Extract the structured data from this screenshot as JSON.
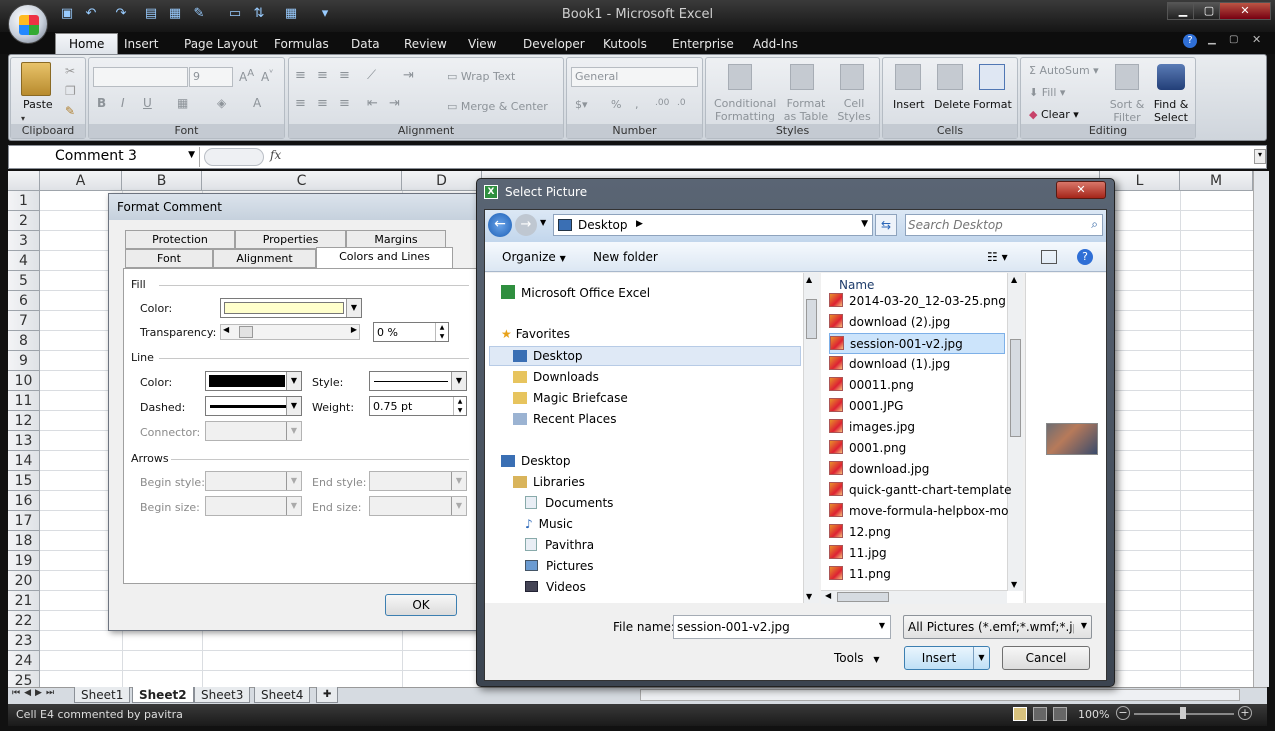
{
  "window": {
    "title": "Book1 - Microsoft Excel"
  },
  "ribbon_tabs": [
    "Home",
    "Insert",
    "Page Layout",
    "Formulas",
    "Data",
    "Review",
    "View",
    "Developer",
    "Kutools",
    "Enterprise",
    "Add-Ins"
  ],
  "ribbon": {
    "clipboard": {
      "label": "Clipboard",
      "paste": "Paste"
    },
    "font": {
      "label": "Font",
      "size": "9"
    },
    "alignment": {
      "label": "Alignment",
      "wrap_text": "Wrap Text",
      "merge_center": "Merge & Center"
    },
    "number": {
      "label": "Number",
      "format": "General"
    },
    "styles": {
      "label": "Styles",
      "conditional_1": "Conditional",
      "conditional_2": "Formatting",
      "format_table_1": "Format",
      "format_table_2": "as Table",
      "cell_styles_1": "Cell",
      "cell_styles_2": "Styles"
    },
    "cells": {
      "label": "Cells",
      "insert": "Insert",
      "delete": "Delete",
      "format": "Format"
    },
    "editing": {
      "label": "Editing",
      "autosum": "AutoSum",
      "fill": "Fill",
      "clear": "Clear",
      "sort_1": "Sort &",
      "sort_2": "Filter",
      "find_1": "Find &",
      "find_2": "Select"
    }
  },
  "formula_bar": {
    "name_box": "Comment 3",
    "fx": "fx",
    "formula": ""
  },
  "columns": [
    "A",
    "B",
    "C",
    "D",
    "L",
    "M"
  ],
  "rows": [
    "1",
    "2",
    "3",
    "4",
    "5",
    "6",
    "7",
    "8",
    "9",
    "10",
    "11",
    "12",
    "13",
    "14",
    "15",
    "16",
    "17",
    "18",
    "19",
    "20",
    "21",
    "22",
    "23",
    "24",
    "25"
  ],
  "sheets": [
    "Sheet1",
    "Sheet2",
    "Sheet3",
    "Sheet4"
  ],
  "active_sheet": "Sheet2",
  "status": {
    "text": "Cell E4 commented by pavitra",
    "zoom": "100%"
  },
  "format_comment": {
    "title": "Format Comment",
    "tabs_row1": [
      "Protection",
      "Properties",
      "Margins"
    ],
    "tabs_row2": [
      "Font",
      "Alignment",
      "Colors and Lines"
    ],
    "active_tab": "Colors and Lines",
    "fill_label": "Fill",
    "color_label": "Color:",
    "transparency_label": "Transparency:",
    "transparency_value": "0 %",
    "line_label": "Line",
    "line_color_label": "Color:",
    "style_label": "Style:",
    "dashed_label": "Dashed:",
    "weight_label": "Weight:",
    "weight_value": "0.75 pt",
    "connector_label": "Connector:",
    "arrows_label": "Arrows",
    "begin_style_label": "Begin style:",
    "end_style_label": "End style:",
    "begin_size_label": "Begin size:",
    "end_size_label": "End size:",
    "ok": "OK",
    "fill_color": "#ffffcc",
    "line_color": "#000000"
  },
  "select_picture": {
    "title": "Select Picture",
    "location": "Desktop",
    "search_placeholder": "Search Desktop",
    "organize": "Organize",
    "new_folder": "New folder",
    "name_header": "Name",
    "nav": {
      "top": "Microsoft Office Excel",
      "favorites": "Favorites",
      "fav_items": [
        "Desktop",
        "Downloads",
        "Magic Briefcase",
        "Recent Places"
      ],
      "desktop": "Desktop",
      "libraries": "Libraries",
      "lib_items": [
        "Documents",
        "Music",
        "Pavithra",
        "Pictures",
        "Videos"
      ]
    },
    "files": [
      "2014-03-20_12-03-25.png",
      "download (2).jpg",
      "session-001-v2.jpg",
      "download (1).jpg",
      "00011.png",
      "0001.JPG",
      "images.jpg",
      "0001.png",
      "download.jpg",
      "quick-gantt-chart-template",
      "move-formula-helpbox-mo",
      "12.png",
      "11.jpg",
      "11.png"
    ],
    "selected_file": "session-001-v2.jpg",
    "file_name_label": "File name:",
    "file_name_value": "session-001-v2.jpg",
    "file_type": "All Pictures (*.emf;*.wmf;*.jpg;*",
    "tools": "Tools",
    "insert": "Insert",
    "cancel": "Cancel"
  }
}
